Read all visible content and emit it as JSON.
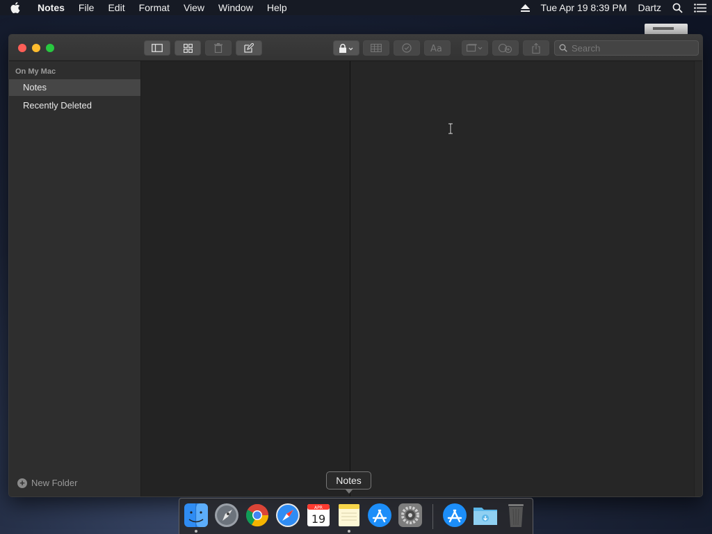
{
  "menubar": {
    "app_name": "Notes",
    "menus": [
      "File",
      "Edit",
      "Format",
      "View",
      "Window",
      "Help"
    ],
    "datetime": "Tue Apr 19  8:39 PM",
    "user": "Dartz"
  },
  "toolbar": {
    "search_placeholder": "Search"
  },
  "sidebar": {
    "section_title": "On My Mac",
    "folders": [
      {
        "label": "Notes",
        "selected": true
      },
      {
        "label": "Recently Deleted",
        "selected": false
      }
    ],
    "new_folder_label": "New Folder"
  },
  "dock": {
    "tooltip": "Notes",
    "calendar_month": "APR",
    "calendar_day": "19",
    "apps": [
      "Finder",
      "Launchpad",
      "Google Chrome",
      "Safari",
      "Calendar",
      "Notes",
      "App Store",
      "System Preferences",
      "App Store",
      "Downloads",
      "Trash"
    ]
  },
  "colors": {
    "close": "#ff5f57",
    "minimize": "#febc2e",
    "maximize": "#28c840",
    "sidebar_selected": "#464646"
  }
}
